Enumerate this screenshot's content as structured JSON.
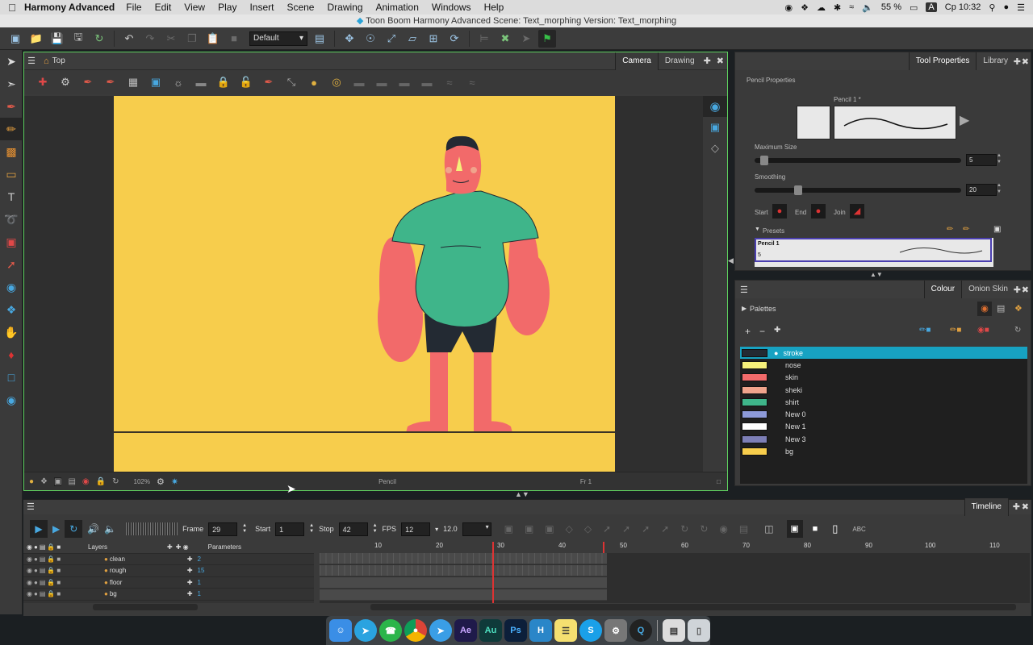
{
  "menubar": {
    "app_name": "Harmony Advanced",
    "items": [
      "File",
      "Edit",
      "View",
      "Play",
      "Insert",
      "Scene",
      "Drawing",
      "Animation",
      "Windows",
      "Help"
    ],
    "battery": "55 %",
    "input_lang": "A",
    "clock": "Ср 10:32"
  },
  "window_title": "Toon Boom Harmony Advanced Scene: Text_morphing Version: Text_morphing",
  "main_toolbar": {
    "workspace_select": "Default"
  },
  "camera": {
    "breadcrumb": "Top",
    "tabs": [
      "Camera",
      "Drawing"
    ],
    "zoom": "102%",
    "tool_name": "Pencil",
    "frame_indicator": "Fr 1"
  },
  "tool_properties": {
    "tabs": [
      "Tool Properties",
      "Library"
    ],
    "section_title": "Pencil Properties",
    "preset_name": "Pencil 1 *",
    "max_size_label": "Maximum Size",
    "max_size_value": "5",
    "max_size_fraction": 0.03,
    "smoothing_label": "Smoothing",
    "smoothing_value": "20",
    "smoothing_fraction": 0.2,
    "start_label": "Start",
    "end_label": "End",
    "join_label": "Join",
    "presets_label": "Presets",
    "presets": [
      {
        "name": "Pencil 1",
        "size": "5"
      }
    ]
  },
  "colour": {
    "tabs": [
      "Colour",
      "Onion Skin"
    ],
    "palettes_label": "Palettes",
    "swatches": [
      {
        "name": "stroke",
        "color": "#232a33",
        "selected": true
      },
      {
        "name": "nose",
        "color": "#f5f07a",
        "selected": false
      },
      {
        "name": "skin",
        "color": "#f26a6a",
        "selected": false
      },
      {
        "name": "sheki",
        "color": "#f0a48c",
        "selected": false
      },
      {
        "name": "shirt",
        "color": "#3fb58a",
        "selected": false
      },
      {
        "name": "New 0",
        "color": "#8d9ad9",
        "selected": false
      },
      {
        "name": "New 1",
        "color": "#ffffff",
        "selected": false
      },
      {
        "name": "New 3",
        "color": "#7d7fb6",
        "selected": false
      },
      {
        "name": "bg",
        "color": "#f7cd4c",
        "selected": false
      }
    ]
  },
  "timeline": {
    "title": "Timeline",
    "frame_label": "Frame",
    "frame_value": "29",
    "start_label": "Start",
    "start_value": "1",
    "stop_label": "Stop",
    "stop_value": "42",
    "fps_label": "FPS",
    "fps_value": "12",
    "fps_real": "12.0",
    "layers_header": "Layers",
    "params_header": "Parameters",
    "layers": [
      {
        "name": "clean",
        "param": "2"
      },
      {
        "name": "rough",
        "param": "15"
      },
      {
        "name": "floor",
        "param": "1"
      },
      {
        "name": "bg",
        "param": "1"
      }
    ],
    "ruler_ticks": [
      "10",
      "20",
      "30",
      "40",
      "50",
      "60",
      "70",
      "80",
      "90",
      "100",
      "110"
    ],
    "current_frame": 29,
    "stop_frame": 42
  },
  "dock_apps": [
    "Finder",
    "Telegram",
    "WhatsApp",
    "Chrome",
    "Safari",
    "Ae",
    "Au",
    "Ps",
    "Harmony",
    "Notes",
    "Skype",
    "System Preferences",
    "QuickTime",
    "Preview",
    "Trash"
  ]
}
